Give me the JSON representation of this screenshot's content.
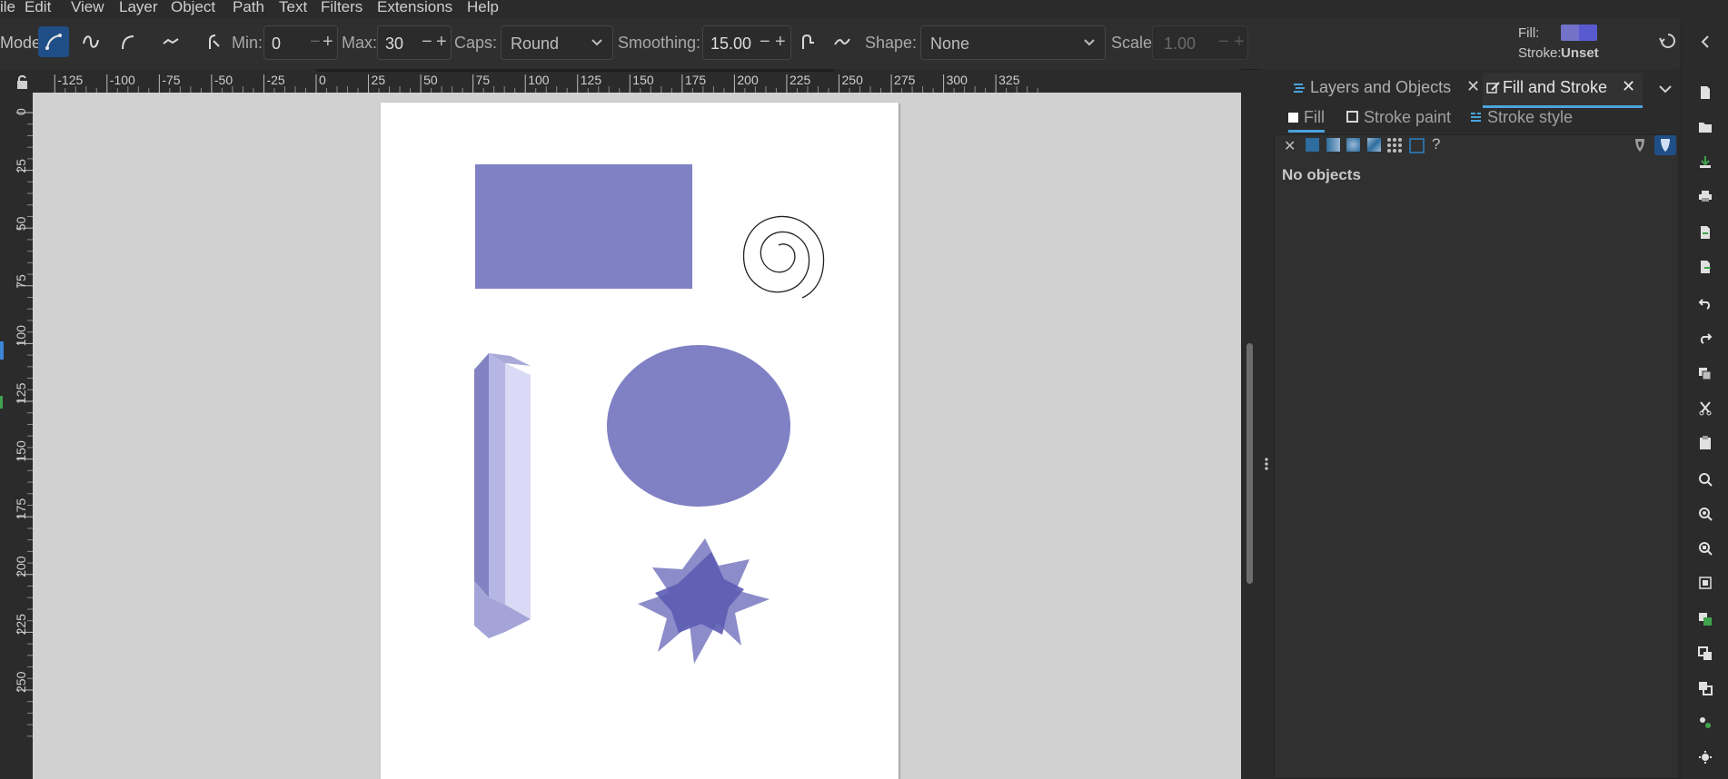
{
  "menu": {
    "items": [
      "ile",
      "Edit",
      "View",
      "Layer",
      "Object",
      "Path",
      "Text",
      "Filters",
      "Extensions",
      "Help"
    ]
  },
  "toolbar": {
    "mode_label": "Mode",
    "min_label": "Min:",
    "min_value": "0",
    "max_label": "Max:",
    "max_value": "30",
    "caps_label": "Caps:",
    "caps_value": "Round",
    "smoothing_label": "Smoothing:",
    "smoothing_value": "15.00",
    "shape_label": "Shape:",
    "shape_value": "None",
    "scale_label": "Scale:",
    "scale_value": "1.00",
    "fill_label": "Fill:",
    "stroke_label": "Stroke:",
    "stroke_value": "Unset",
    "fill_swatch_color": "#6c6cc4"
  },
  "ruler": {
    "horizontal": [
      "-125",
      "-100",
      "-75",
      "-50",
      "-25",
      "0",
      "25",
      "50",
      "75",
      "100",
      "125",
      "150",
      "175",
      "200",
      "225",
      "250",
      "275",
      "300",
      "325"
    ],
    "vertical": [
      "0",
      "25",
      "50",
      "75",
      "100",
      "125",
      "150",
      "175",
      "200",
      "225",
      "250"
    ]
  },
  "dock": {
    "tabs": [
      {
        "label": "Layers and Objects"
      },
      {
        "label": "Fill and Stroke"
      }
    ],
    "subtabs": [
      "Fill",
      "Stroke paint",
      "Stroke style"
    ],
    "status": "No objects",
    "paint_help": "?"
  },
  "canvas": {
    "shape_color": "#8080c4",
    "star_color": "#5b5bb2",
    "page_color": "#ffffff"
  }
}
